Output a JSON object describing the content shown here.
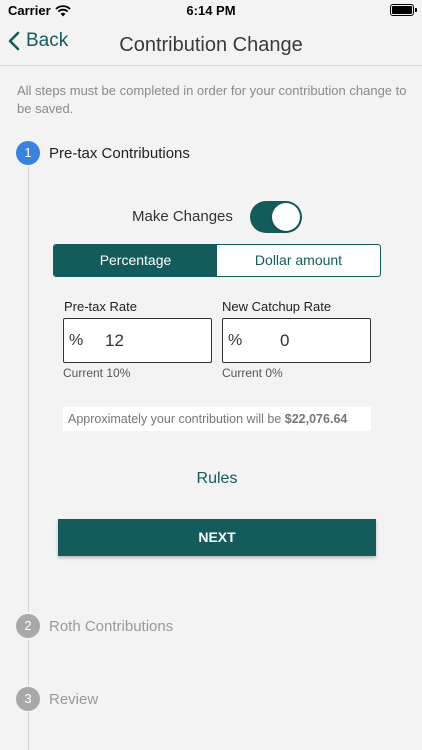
{
  "status": {
    "carrier": "Carrier",
    "time": "6:14 PM"
  },
  "nav": {
    "back_label": "Back",
    "title": "Contribution Change"
  },
  "notice": "All steps must be completed in order for your contribution change to be saved.",
  "steps": [
    {
      "number": "1",
      "label": "Pre-tax Contributions",
      "state": "active"
    },
    {
      "number": "2",
      "label": "Roth Contributions",
      "state": "inactive"
    },
    {
      "number": "3",
      "label": "Review",
      "state": "inactive"
    }
  ],
  "make_changes": {
    "label": "Make Changes",
    "on": true
  },
  "mode": {
    "options": [
      "Percentage",
      "Dollar amount"
    ],
    "selected": "Percentage"
  },
  "fields": {
    "pretax": {
      "label": "Pre-tax Rate",
      "prefix": "%",
      "value": "12",
      "hint": "Current 10%"
    },
    "catchup": {
      "label": "New Catchup Rate",
      "prefix": "%",
      "value": "0",
      "hint": "Current 0%"
    }
  },
  "estimate": {
    "text": "Approximately your contribution will be ",
    "amount": "$22,076.64"
  },
  "rules_label": "Rules",
  "next_label": "NEXT",
  "colors": {
    "brand": "#145c5c",
    "step_active": "#3b82e0",
    "step_inactive": "#a8a8a8",
    "background": "#f3f3f3"
  }
}
